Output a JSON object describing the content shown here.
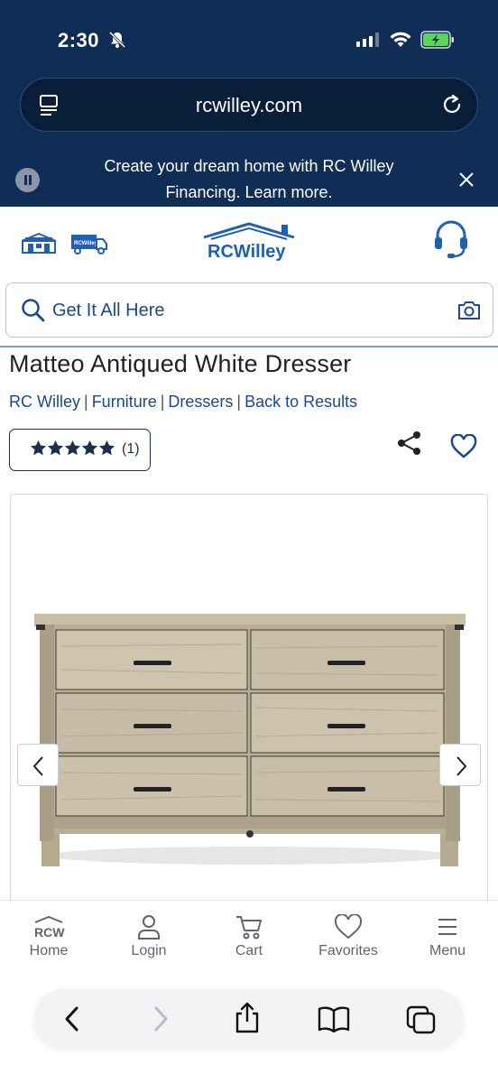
{
  "status_bar": {
    "time": "2:30"
  },
  "browser": {
    "url": "rcwilley.com"
  },
  "promo": {
    "text": "Create your dream home with RC Willey Financing. Learn more."
  },
  "header": {
    "logo_text": "RCWilley",
    "truck_text": "RCWilley"
  },
  "search": {
    "placeholder": "Get It All Here"
  },
  "product": {
    "title": "Matteo Antiqued White Dresser",
    "breadcrumb": [
      "RC Willey",
      "Furniture",
      "Dressers",
      "Back to Results"
    ],
    "rating_count": "(1)",
    "rating_stars": 5
  },
  "bottom_nav": {
    "items": [
      {
        "label": "Home",
        "icon": "rcw-home-icon",
        "logo": "RCW"
      },
      {
        "label": "Login",
        "icon": "user-icon"
      },
      {
        "label": "Cart",
        "icon": "cart-icon"
      },
      {
        "label": "Favorites",
        "icon": "heart-icon"
      },
      {
        "label": "Menu",
        "icon": "hamburger-icon"
      }
    ]
  },
  "colors": {
    "navy": "#0f2d55",
    "link_blue": "#1b4a8a",
    "brand_blue": "#1f5fb5"
  }
}
